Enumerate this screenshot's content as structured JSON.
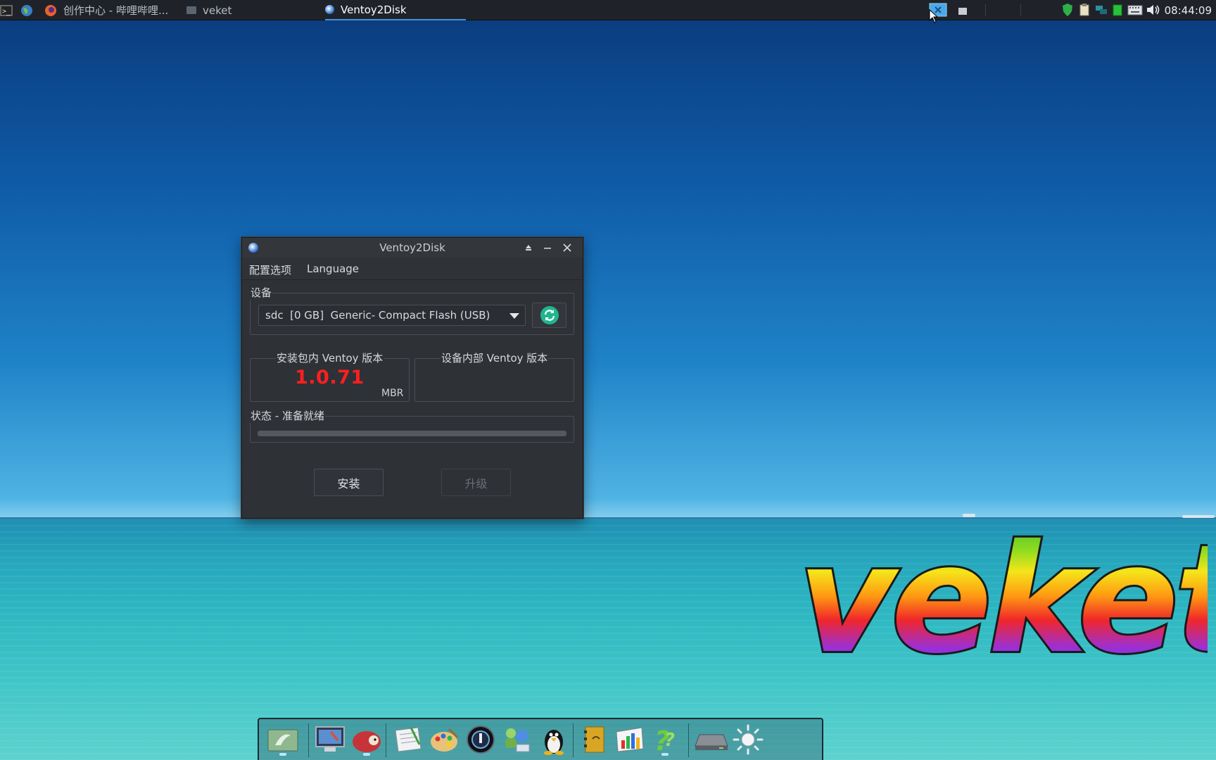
{
  "taskbar": {
    "tasks": [
      {
        "label": "创作中心 - 哔哩哔哩..."
      },
      {
        "label": "veket"
      },
      {
        "label": "Ventoy2Disk"
      }
    ],
    "clock": "08:44:09"
  },
  "window": {
    "title": "Ventoy2Disk",
    "menu": [
      "配置选项",
      "Language"
    ],
    "device_group_label": "设备",
    "device_combo_value": "sdc  [0 GB]  Generic- Compact Flash (USB)",
    "pkg_version_label": "安装包内 Ventoy 版本",
    "pkg_version_value": "1.0.71",
    "partition_style": "MBR",
    "dev_version_label": "设备内部 Ventoy 版本",
    "dev_version_value": "",
    "status_label": "状态 - 准备就绪",
    "progress": 0,
    "install_button": "安装",
    "upgrade_button": "升级"
  },
  "desktop": {
    "logo_text": "veket"
  },
  "colors": {
    "version_red": "#ff1f1f",
    "refresh_green": "#1fb58f",
    "taskbar_bg": "#1f2329",
    "window_bg": "#2e3136"
  },
  "dock": {
    "icons": [
      "desktop-bird-icon",
      "monitor-settings-icon",
      "hedgehog-icon",
      "notepad-icon",
      "paint-palette-icon",
      "media-player-icon",
      "network-people-icon",
      "penguin-icon",
      "address-book-icon",
      "chart-icon",
      "help-question-icon",
      "drive-icon",
      "brightness-sun-icon"
    ]
  }
}
